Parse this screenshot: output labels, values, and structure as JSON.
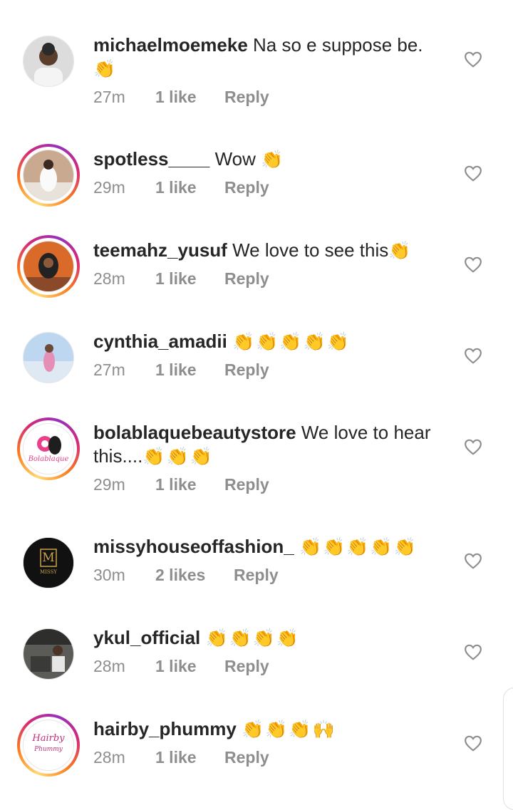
{
  "comments": [
    {
      "username": "michaelmoemeke",
      "text": "Na so e suppose be.",
      "emoji": "👏",
      "time": "27m",
      "likes": "1 like",
      "reply": "Reply"
    },
    {
      "username": "spotless____",
      "text": "Wow",
      "emoji": "👏",
      "time": "29m",
      "likes": "1 like",
      "reply": "Reply"
    },
    {
      "username": "teemahz_yusuf",
      "text": "We love to see this",
      "emoji": "👏",
      "time": "28m",
      "likes": "1 like",
      "reply": "Reply"
    },
    {
      "username": "cynthia_amadii",
      "text": "",
      "emoji": "👏👏👏👏👏",
      "time": "27m",
      "likes": "1 like",
      "reply": "Reply"
    },
    {
      "username": "bolablaquebeautystore",
      "text": "We love to hear",
      "text2": "this....",
      "emoji": "👏👏👏",
      "time": "29m",
      "likes": "1 like",
      "reply": "Reply",
      "avatar_logo": "Bolablaque"
    },
    {
      "username": "missyhouseoffashion_",
      "text": "",
      "emoji": "👏👏👏👏👏",
      "time": "30m",
      "likes": "2 likes",
      "reply": "Reply",
      "avatar_logo": "M",
      "avatar_logo2": "MISSY"
    },
    {
      "username": "ykul_official",
      "text": "",
      "emoji": "👏👏👏👏",
      "time": "28m",
      "likes": "1 like",
      "reply": "Reply"
    },
    {
      "username": "hairby_phummy",
      "text": "",
      "emoji": "👏👏👏🙌",
      "time": "28m",
      "likes": "1 like",
      "reply": "Reply",
      "avatar_logo": "Hairby",
      "avatar_logo2": "Phummy"
    }
  ],
  "icons": {
    "like": "heart-outline-icon"
  },
  "colors": {
    "username": "#262626",
    "meta": "#8e8e8e",
    "emoji": "#f2b705",
    "heart": "#8e8e8e"
  }
}
